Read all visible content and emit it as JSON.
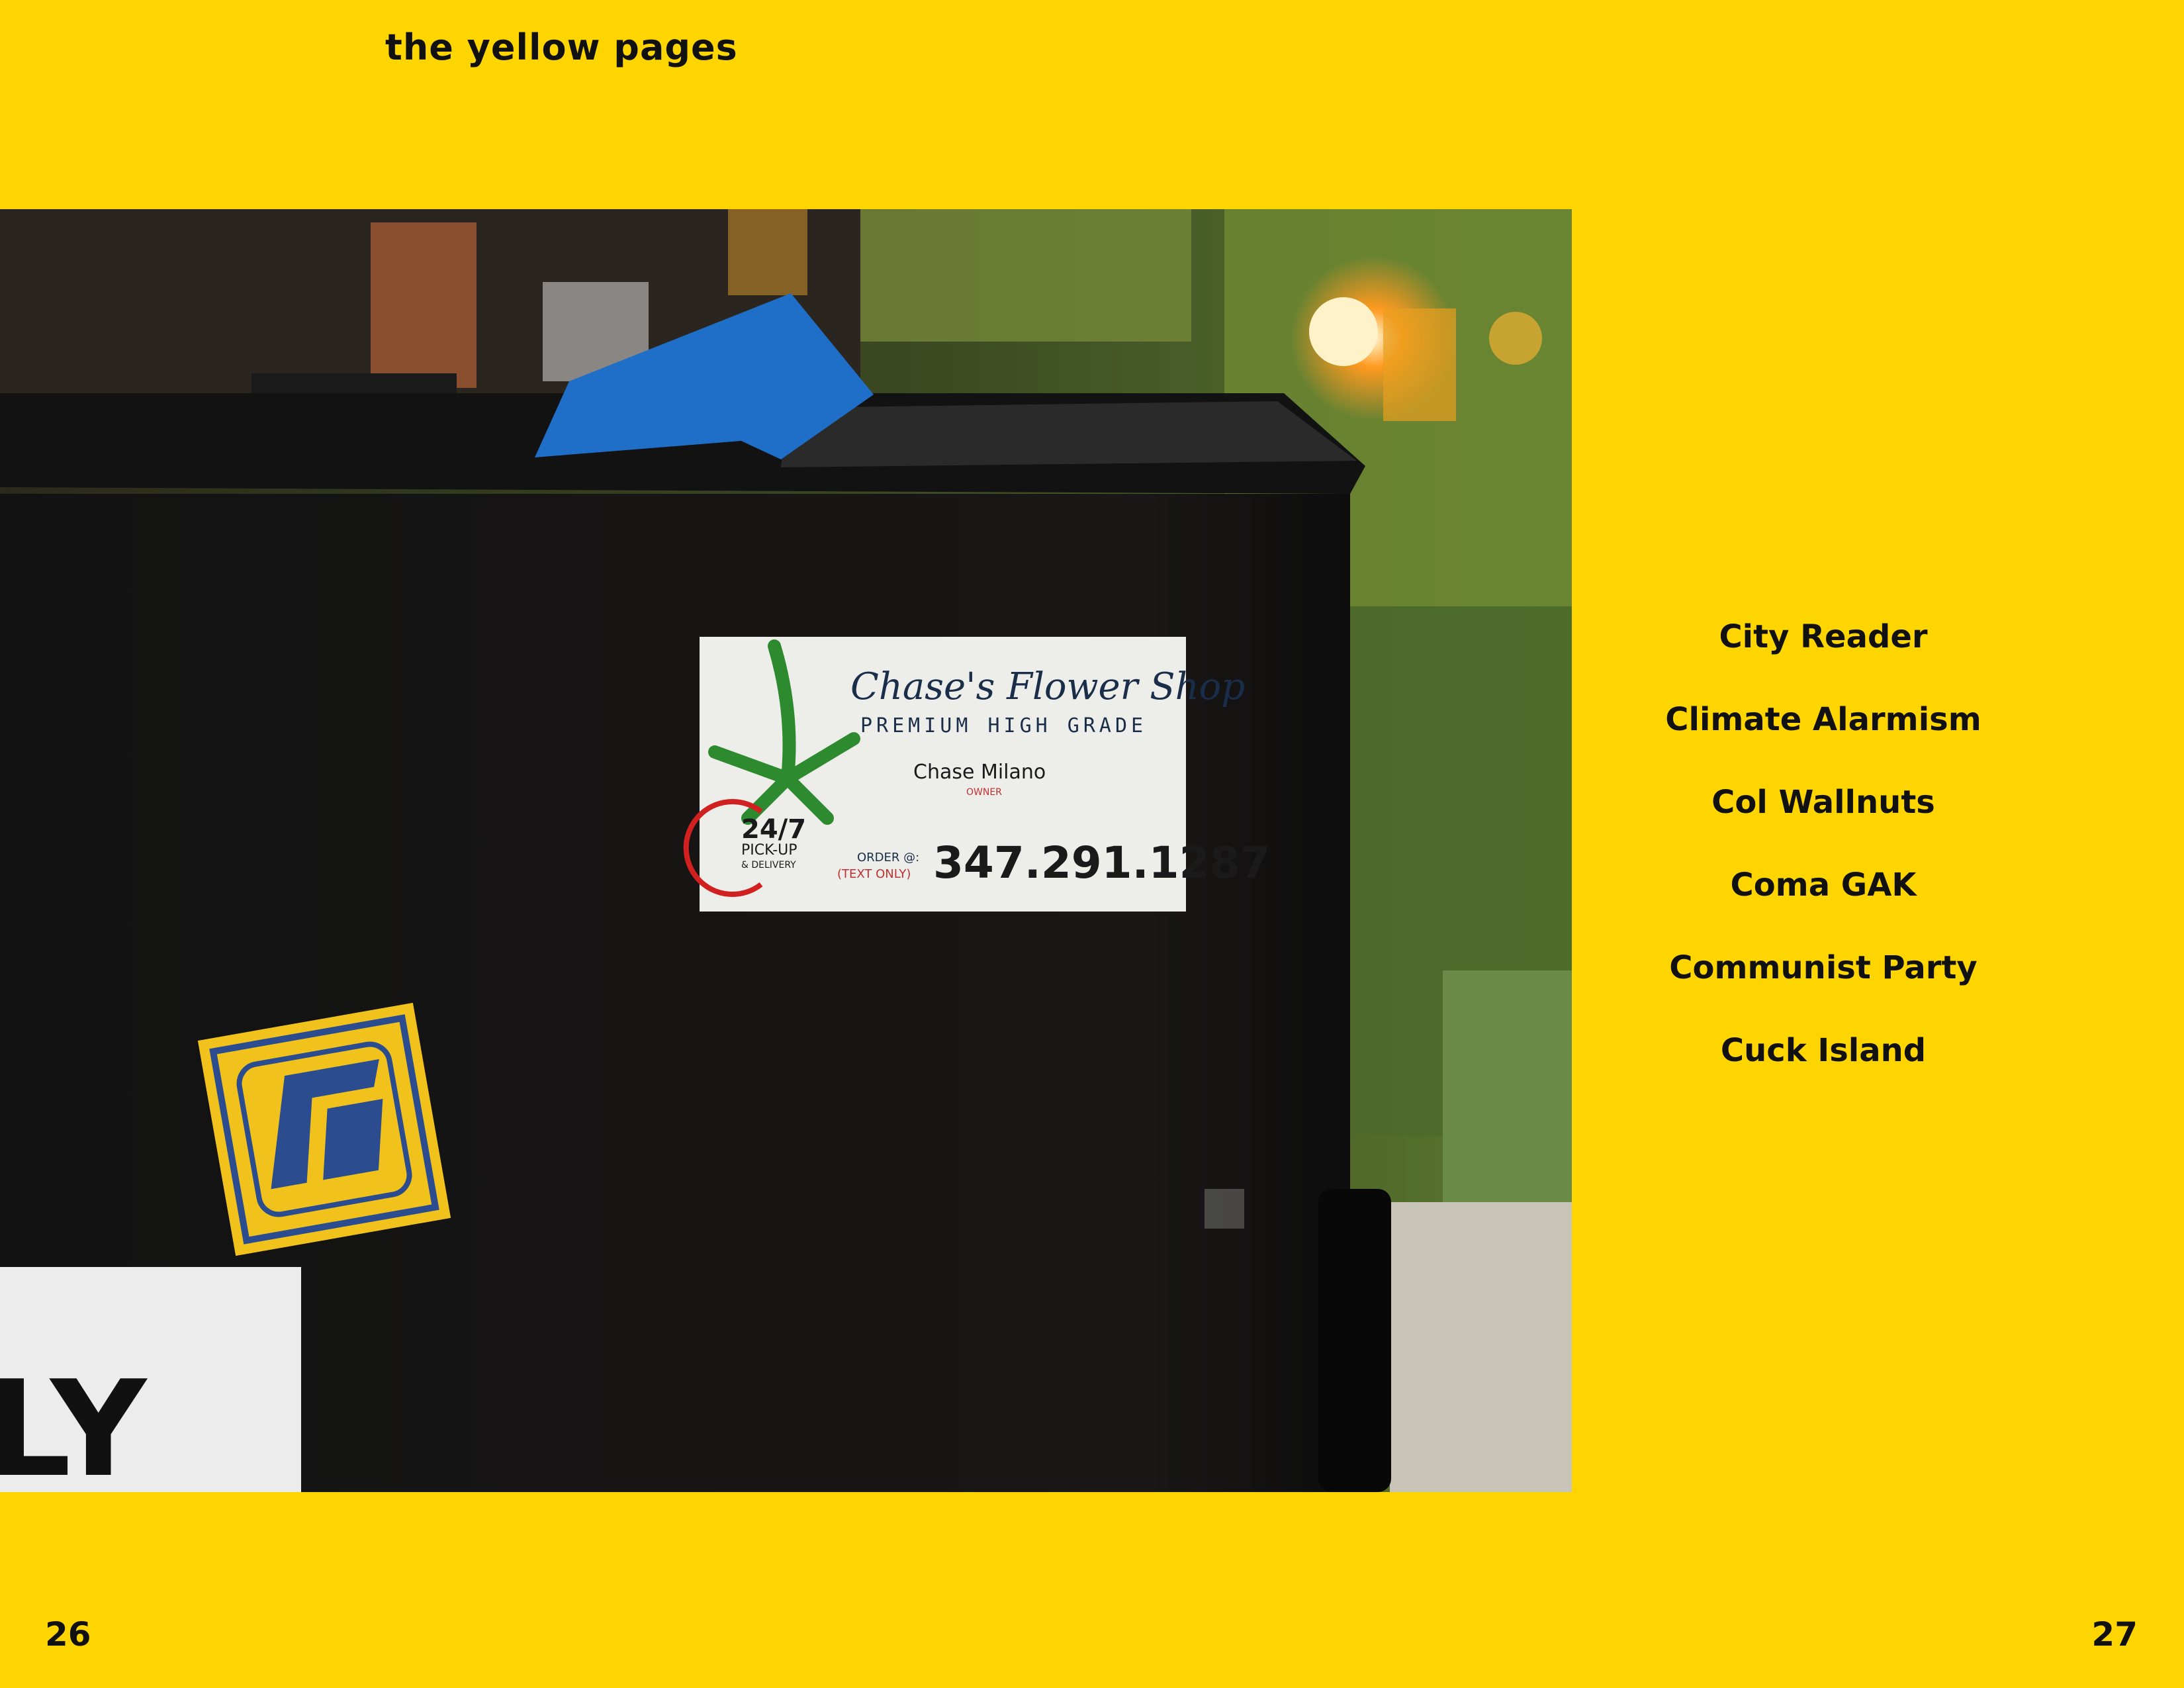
{
  "header": {
    "title": "the yellow pages"
  },
  "photo": {
    "sticker_flower_shop": {
      "name": "Chase's Flower Shop",
      "tagline": "PREMIUM HIGH GRADE",
      "owner_name": "Chase Milano",
      "owner_role": "OWNER",
      "badge_main": "24/7",
      "badge_line1": "PICK-UP",
      "badge_line2": "& DELIVERY",
      "order_label": "ORDER @:",
      "order_note": "(TEXT ONLY)",
      "phone": "347.291.1287"
    },
    "sign_fragment_text": "LY"
  },
  "directory": {
    "items": [
      "City Reader",
      "Climate Alarmism",
      "Col Wallnuts",
      "Coma GAK",
      "Communist Party",
      "Cuck Island"
    ]
  },
  "footer": {
    "page_left": "26",
    "page_right": "27"
  },
  "colors": {
    "background": "#FFD500",
    "text": "#111111"
  }
}
